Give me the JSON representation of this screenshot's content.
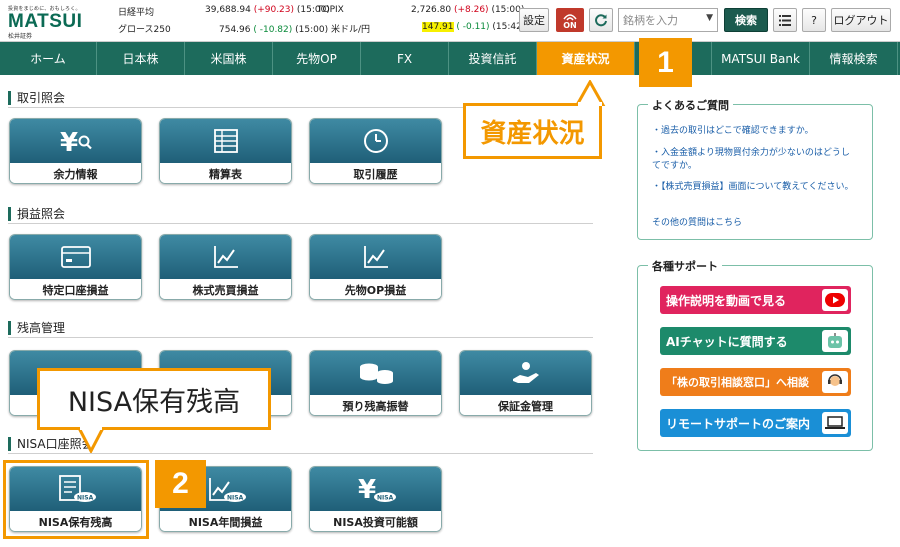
{
  "header": {
    "logo_tagline": "投資をまじめに、おもしろく。",
    "logo_name": "MATSUI",
    "logo_sub": "松井証券",
    "indices": [
      {
        "name": "日経平均",
        "value": "39,688.94",
        "change": "(+90.23)",
        "time": "(15:00)",
        "dir": "up"
      },
      {
        "name": "グロース250",
        "value": "754.96",
        "change": "( -10.82)",
        "time": "(15:00)",
        "dir": "down"
      },
      {
        "name": "TOPIX",
        "value": "2,726.80",
        "change": "(+8.26)",
        "time": "(15:00)",
        "dir": "up"
      },
      {
        "name": "米ドル/円",
        "value": "147.91",
        "change": "( -0.11)",
        "time": "(15:42)",
        "dir": "down"
      }
    ],
    "settings_label": "設定",
    "on_label": "ON",
    "search_placeholder": "銘柄を入力",
    "search_button": "検索",
    "help_label": "?",
    "logout_label": "ログアウト"
  },
  "nav": {
    "items": [
      "ホーム",
      "日本株",
      "米国株",
      "先物OP",
      "FX",
      "投資信託",
      "資産状況",
      "",
      "MATSUI Bank",
      "情報検索"
    ]
  },
  "sections": [
    {
      "title": "取引照会",
      "tiles": [
        "余力情報",
        "精算表",
        "取引履歴"
      ]
    },
    {
      "title": "損益照会",
      "tiles": [
        "特定口座損益",
        "株式売買損益",
        "先物OP損益"
      ]
    },
    {
      "title": "残高管理",
      "tiles": [
        "",
        "",
        "預り残高振替",
        "保証金管理"
      ]
    },
    {
      "title": "NISA口座照会",
      "tiles": [
        "NISA保有残高",
        "NISA年間損益",
        "NISA投資可能額"
      ]
    }
  ],
  "callouts": {
    "asset_status": "資産状況",
    "nisa_holdings": "NISA保有残高",
    "step1": "1",
    "step2": "2"
  },
  "faq": {
    "title": "よくあるご質問",
    "items": [
      "・過去の取引はどこで確認できますか。",
      "・入金金額より現物買付余力が少ないのはどうしてですか。",
      "・【株式売買損益】画面について教えてください。"
    ],
    "more": "その他の質問はこちら"
  },
  "support": {
    "title": "各種サポート",
    "buttons": [
      {
        "label": "操作説明を動画で見る",
        "color": "#e0245e",
        "icon": "play-icon"
      },
      {
        "label": "AIチャットに質問する",
        "color": "#1d8a6b",
        "icon": "robot-icon"
      },
      {
        "label": "「株の取引相談窓口」へ相談",
        "color": "#ef7d1a",
        "icon": "operator-icon"
      },
      {
        "label": "リモートサポートのご案内",
        "color": "#1a8fd6",
        "icon": "laptop-icon"
      }
    ]
  }
}
